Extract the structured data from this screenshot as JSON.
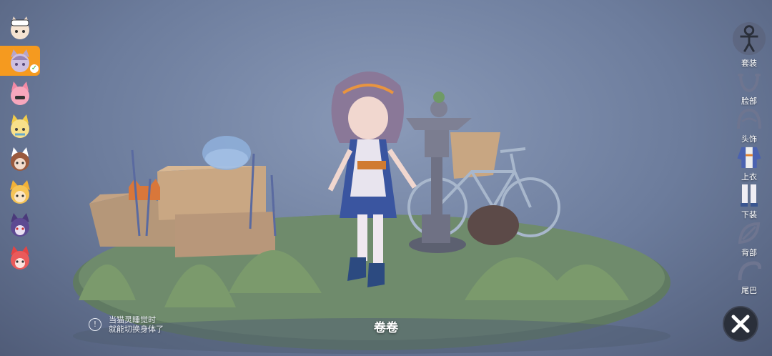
{
  "characters": [
    {
      "name": "cat-avatar-white-cap",
      "selected": false
    },
    {
      "name": "cat-avatar-lavender",
      "selected": true
    },
    {
      "name": "cat-avatar-pink",
      "selected": false
    },
    {
      "name": "cat-avatar-yellow",
      "selected": false
    },
    {
      "name": "cat-avatar-brown",
      "selected": false
    },
    {
      "name": "cat-avatar-orange",
      "selected": false
    },
    {
      "name": "cat-avatar-purple",
      "selected": false
    },
    {
      "name": "cat-avatar-red",
      "selected": false
    }
  ],
  "categories": [
    {
      "label": "套装",
      "icon": "outfit-set-icon"
    },
    {
      "label": "脸部",
      "icon": "face-icon"
    },
    {
      "label": "头饰",
      "icon": "headwear-icon"
    },
    {
      "label": "上衣",
      "icon": "top-icon"
    },
    {
      "label": "下装",
      "icon": "bottom-icon"
    },
    {
      "label": "背部",
      "icon": "back-icon"
    },
    {
      "label": "尾巴",
      "icon": "tail-icon"
    }
  ],
  "hint": {
    "line1": "当猫灵睡觉时",
    "line2": "就能切换身体了"
  },
  "character_name": "卷卷",
  "colors": {
    "selected_bg": "#f59a1f",
    "accent_orange": "#f08a24"
  }
}
